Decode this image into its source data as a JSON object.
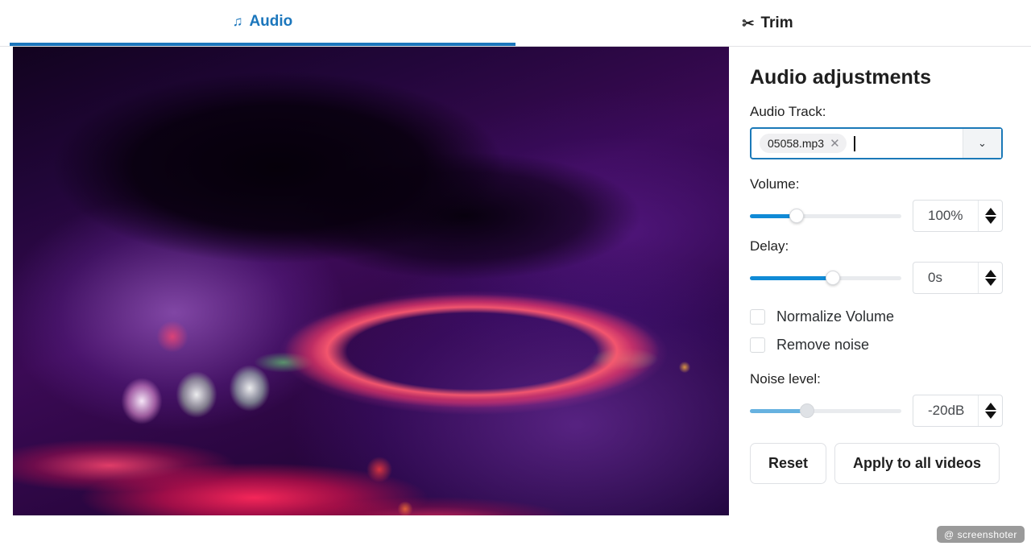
{
  "tabs": [
    {
      "id": "audio",
      "label": "Audio",
      "icon": "music-note-icon",
      "glyph": "♫",
      "active": true,
      "accent": "#1b76bc"
    },
    {
      "id": "trim",
      "label": "Trim",
      "icon": "scissors-icon",
      "glyph": "✂",
      "active": false,
      "accent": "#1f1f1f"
    }
  ],
  "preview": {
    "name": "video-preview",
    "description": "Blurred neon-lit DJ controller with a hand above it, purple and pink glow"
  },
  "panel": {
    "title": "Audio adjustments",
    "audio_track": {
      "label": "Audio Track:",
      "chips": [
        {
          "name": "05058.mp3",
          "remove_glyph": "✕"
        }
      ],
      "placeholder": "",
      "dropdown_glyph": "⌄",
      "focused": true,
      "border_color": "#1b79b8"
    },
    "volume": {
      "label": "Volume:",
      "value": "100%",
      "slider_percent": 31,
      "disabled": false
    },
    "delay": {
      "label": "Delay:",
      "value": "0s",
      "slider_percent": 55,
      "disabled": false
    },
    "normalize_volume": {
      "label": "Normalize Volume",
      "checked": false
    },
    "remove_noise": {
      "label": "Remove noise",
      "checked": false
    },
    "noise_level": {
      "label": "Noise level:",
      "value": "-20dB",
      "slider_percent": 38,
      "disabled": true
    },
    "buttons": {
      "reset": "Reset",
      "apply_all": "Apply to all videos"
    }
  },
  "watermark": {
    "symbol": "@",
    "text": "screenshoter"
  },
  "colors": {
    "accent": "#1b76bc",
    "slider_fill": "#108ad6",
    "slider_fill_disabled": "#67b2e0",
    "text": "#1f1f1f"
  }
}
